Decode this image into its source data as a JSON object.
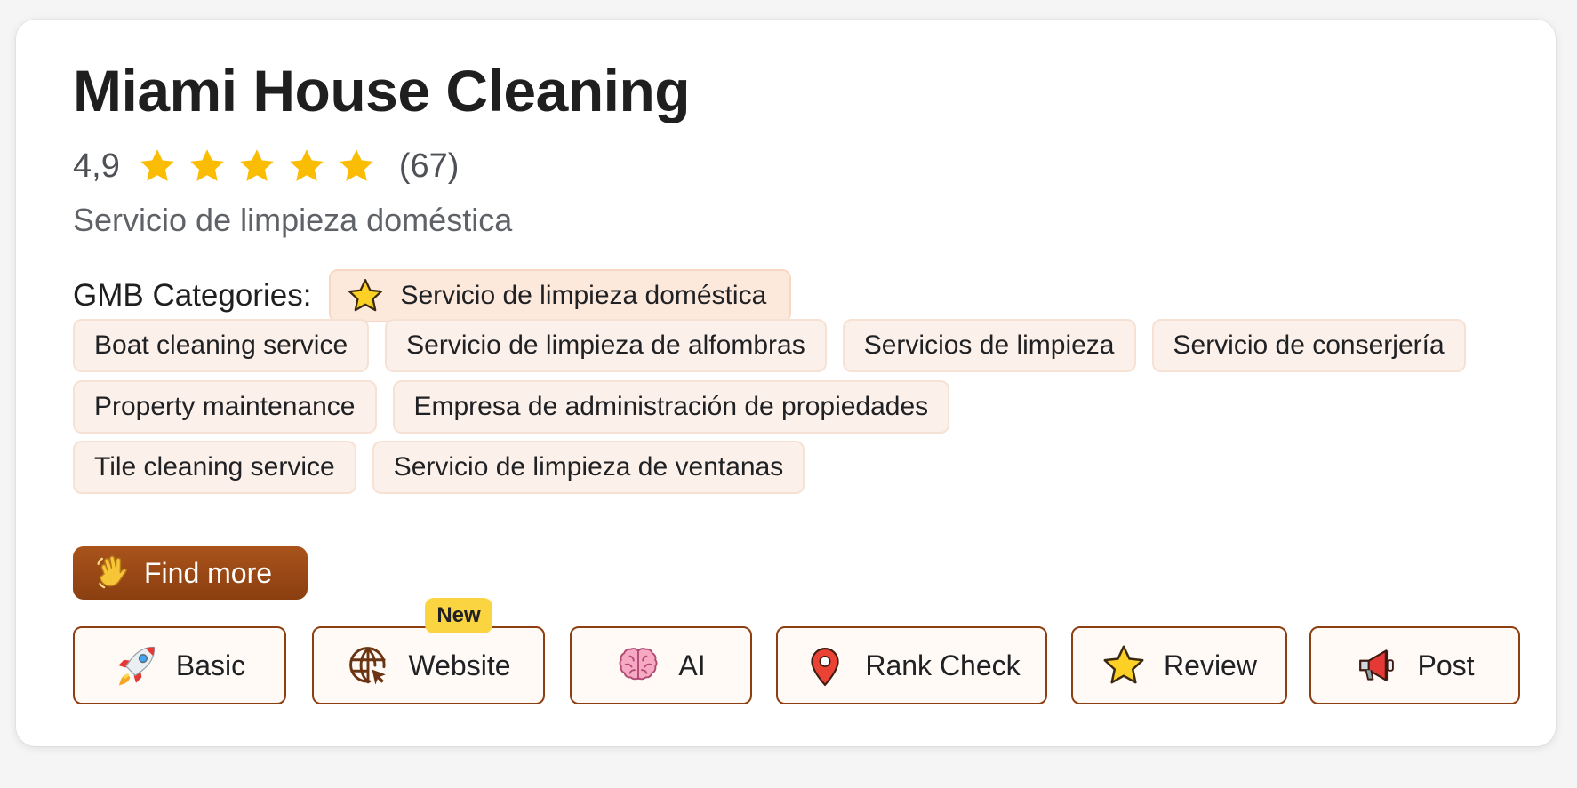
{
  "business": {
    "name": "Miami House Cleaning",
    "rating": "4,9",
    "stars_out_of_5": 5,
    "review_count": "(67)",
    "category": "Servicio de limpieza doméstica"
  },
  "gmb": {
    "label": "GMB Categories:",
    "primary_category": "Servicio de limpieza doméstica",
    "primary_icon": "star-icon",
    "categories": [
      [
        "Boat cleaning service",
        "Servicio de limpieza de alfombras",
        "Servicios de limpieza",
        "Servicio de conserjería"
      ],
      [
        "Property maintenance",
        "Empresa de administración de propiedades"
      ],
      [
        "Tile cleaning service",
        "Servicio de limpieza de ventanas"
      ]
    ]
  },
  "find_more": {
    "label": "Find more",
    "icon": "waving-hand-icon"
  },
  "tools": [
    {
      "label": "Basic",
      "icon": "rocket-icon"
    },
    {
      "label": "Website",
      "icon": "globe-cursor-icon",
      "badge": "New"
    },
    {
      "label": "AI",
      "icon": "brain-icon"
    },
    {
      "label": "Rank Check",
      "icon": "map-pin-icon"
    },
    {
      "label": "Review",
      "icon": "star-icon"
    },
    {
      "label": "Post",
      "icon": "megaphone-icon"
    }
  ],
  "colors": {
    "star": "#fbbc04",
    "chip_bg": "#fcf1ea",
    "accent_brown": "#8e3f12",
    "badge_yellow": "#fbd442"
  }
}
